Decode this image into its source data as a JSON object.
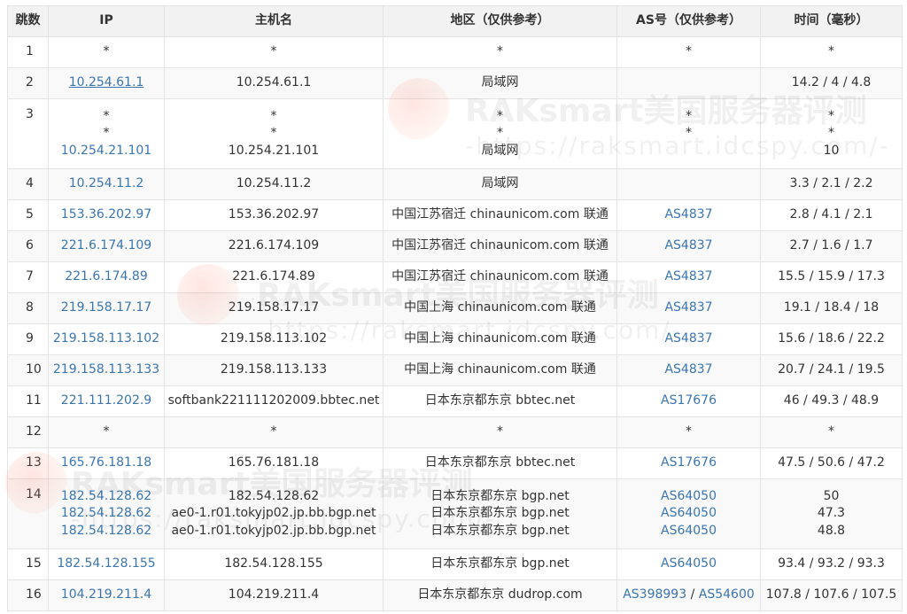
{
  "headers": {
    "hop": "跳数",
    "ip": "IP",
    "host": "主机名",
    "region": "地区（仅供参考）",
    "as": "AS号（仅供参考）",
    "time": "时间（毫秒）"
  },
  "watermark": {
    "brand": "RAKsmart美国服务器评测",
    "url": "-https://raksmart.idcspy.com/-"
  },
  "rows": [
    {
      "hop": "1",
      "ip": [
        "*"
      ],
      "host": [
        "*"
      ],
      "region": [
        "*"
      ],
      "as": [
        "*"
      ],
      "time": [
        "*"
      ]
    },
    {
      "hop": "2",
      "ip": [
        "10.254.61.1"
      ],
      "host": [
        "10.254.61.1"
      ],
      "region": [
        "局域网"
      ],
      "as": [
        ""
      ],
      "time": [
        "14.2 / 4 / 4.8"
      ]
    },
    {
      "hop": "3",
      "ip": [
        "*",
        "*",
        "10.254.21.101"
      ],
      "host": [
        "*",
        "*",
        "10.254.21.101"
      ],
      "region": [
        "*",
        "*",
        "局域网"
      ],
      "as": [
        "*",
        "*",
        ""
      ],
      "time": [
        "*",
        "*",
        "10"
      ]
    },
    {
      "hop": "4",
      "ip": [
        "10.254.11.2"
      ],
      "host": [
        "10.254.11.2"
      ],
      "region": [
        "局域网"
      ],
      "as": [
        ""
      ],
      "time": [
        "3.3 / 2.1 / 2.2"
      ]
    },
    {
      "hop": "5",
      "ip": [
        "153.36.202.97"
      ],
      "host": [
        "153.36.202.97"
      ],
      "region": [
        "中国江苏宿迁 chinaunicom.com 联通"
      ],
      "as": [
        "AS4837"
      ],
      "time": [
        "2.8 / 4.1 / 2.1"
      ]
    },
    {
      "hop": "6",
      "ip": [
        "221.6.174.109"
      ],
      "host": [
        "221.6.174.109"
      ],
      "region": [
        "中国江苏宿迁 chinaunicom.com 联通"
      ],
      "as": [
        "AS4837"
      ],
      "time": [
        "2.7 / 1.6 / 1.7"
      ]
    },
    {
      "hop": "7",
      "ip": [
        "221.6.174.89"
      ],
      "host": [
        "221.6.174.89"
      ],
      "region": [
        "中国江苏宿迁 chinaunicom.com 联通"
      ],
      "as": [
        "AS4837"
      ],
      "time": [
        "15.5 / 15.9 / 17.3"
      ]
    },
    {
      "hop": "8",
      "ip": [
        "219.158.17.17"
      ],
      "host": [
        "219.158.17.17"
      ],
      "region": [
        "中国上海 chinaunicom.com 联通"
      ],
      "as": [
        "AS4837"
      ],
      "time": [
        "19.1 / 18.4 / 18"
      ]
    },
    {
      "hop": "9",
      "ip": [
        "219.158.113.102"
      ],
      "host": [
        "219.158.113.102"
      ],
      "region": [
        "中国上海 chinaunicom.com 联通"
      ],
      "as": [
        "AS4837"
      ],
      "time": [
        "15.6 / 18.6 / 22.2"
      ]
    },
    {
      "hop": "10",
      "ip": [
        "219.158.113.133"
      ],
      "host": [
        "219.158.113.133"
      ],
      "region": [
        "中国上海 chinaunicom.com 联通"
      ],
      "as": [
        "AS4837"
      ],
      "time": [
        "20.7 / 24.1 / 19.5"
      ]
    },
    {
      "hop": "11",
      "ip": [
        "221.111.202.9"
      ],
      "host": [
        "softbank221111202009.bbtec.net"
      ],
      "region": [
        "日本东京都东京 bbtec.net"
      ],
      "as": [
        "AS17676"
      ],
      "time": [
        "46 / 49.3 / 48.9"
      ]
    },
    {
      "hop": "12",
      "ip": [
        "*"
      ],
      "host": [
        "*"
      ],
      "region": [
        "*"
      ],
      "as": [
        "*"
      ],
      "time": [
        "*"
      ]
    },
    {
      "hop": "13",
      "ip": [
        "165.76.181.18"
      ],
      "host": [
        "165.76.181.18"
      ],
      "region": [
        "日本东京都东京 bbtec.net"
      ],
      "as": [
        "AS17676"
      ],
      "time": [
        "47.5 / 50.6 / 47.2"
      ]
    },
    {
      "hop": "14",
      "ip": [
        "182.54.128.62",
        "182.54.128.62",
        "182.54.128.62"
      ],
      "host": [
        "182.54.128.62",
        "ae0-1.r01.tokyjp02.jp.bb.bgp.net",
        "ae0-1.r01.tokyjp02.jp.bb.bgp.net"
      ],
      "region": [
        "日本东京都东京 bgp.net",
        "日本东京都东京 bgp.net",
        "日本东京都东京 bgp.net"
      ],
      "as": [
        "AS64050",
        "AS64050",
        "AS64050"
      ],
      "time": [
        "50",
        "47.3",
        "48.8"
      ]
    },
    {
      "hop": "15",
      "ip": [
        "182.54.128.155"
      ],
      "host": [
        "182.54.128.155"
      ],
      "region": [
        "日本东京都东京 bgp.net"
      ],
      "as": [
        "AS64050"
      ],
      "time": [
        "93.4 / 93.2 / 93.3"
      ]
    },
    {
      "hop": "16",
      "ip": [
        "104.219.211.4"
      ],
      "host": [
        "104.219.211.4"
      ],
      "region": [
        "日本东京都东京 dudrop.com"
      ],
      "as": [
        "AS398993 / AS54600"
      ],
      "time": [
        "107.8 / 107.6 / 107.5"
      ]
    }
  ]
}
